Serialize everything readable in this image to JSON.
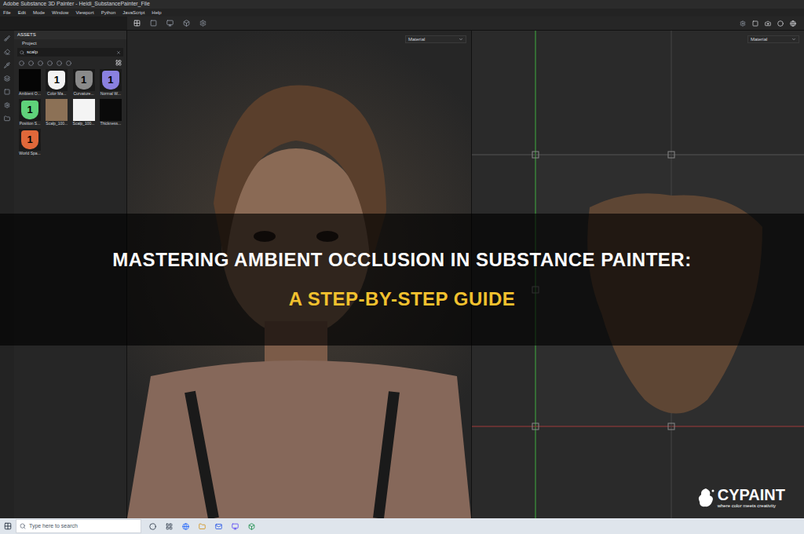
{
  "window": {
    "title": "Adobe Substance 3D Painter - Heidi_SubstancePainter_File"
  },
  "menu": [
    "File",
    "Edit",
    "Mode",
    "Window",
    "Viewport",
    "Python",
    "JavaScript",
    "Help"
  ],
  "assets": {
    "header": "ASSETS",
    "section": "Project",
    "search": "scalp",
    "items": [
      {
        "label": "Ambient O...",
        "kind": "map",
        "badge": "",
        "color": "#050505"
      },
      {
        "label": "Color Ma...",
        "kind": "badge",
        "badge": "1",
        "color": "#f2f2f2"
      },
      {
        "label": "Curvature...",
        "kind": "badge",
        "badge": "1",
        "color": "#8a8a8a"
      },
      {
        "label": "Normal W...",
        "kind": "badge",
        "badge": "1",
        "color": "#8a80e0"
      },
      {
        "label": "Position S...",
        "kind": "badge",
        "badge": "1",
        "color": "#5fd27a"
      },
      {
        "label": "Scalp_100...",
        "kind": "map",
        "badge": "",
        "color": "#8c7156"
      },
      {
        "label": "Scalp_100...",
        "kind": "map",
        "badge": "",
        "color": "#f4f4f4"
      },
      {
        "label": "Thickness...",
        "kind": "map",
        "badge": "",
        "color": "#0a0a0a"
      },
      {
        "label": "World Spa...",
        "kind": "badge",
        "badge": "1",
        "color": "#e0683a"
      }
    ]
  },
  "viewports": [
    {
      "mode": "Material"
    },
    {
      "mode": "Material"
    }
  ],
  "banner": {
    "title": "MASTERING AMBIENT OCCLUSION IN SUBSTANCE PAINTER:",
    "subtitle": "A STEP-BY-STEP GUIDE"
  },
  "watermark": {
    "brand": "CYPAINT",
    "tagline": "where color meets creativity"
  },
  "taskbar": {
    "search_placeholder": "Type here to search"
  }
}
